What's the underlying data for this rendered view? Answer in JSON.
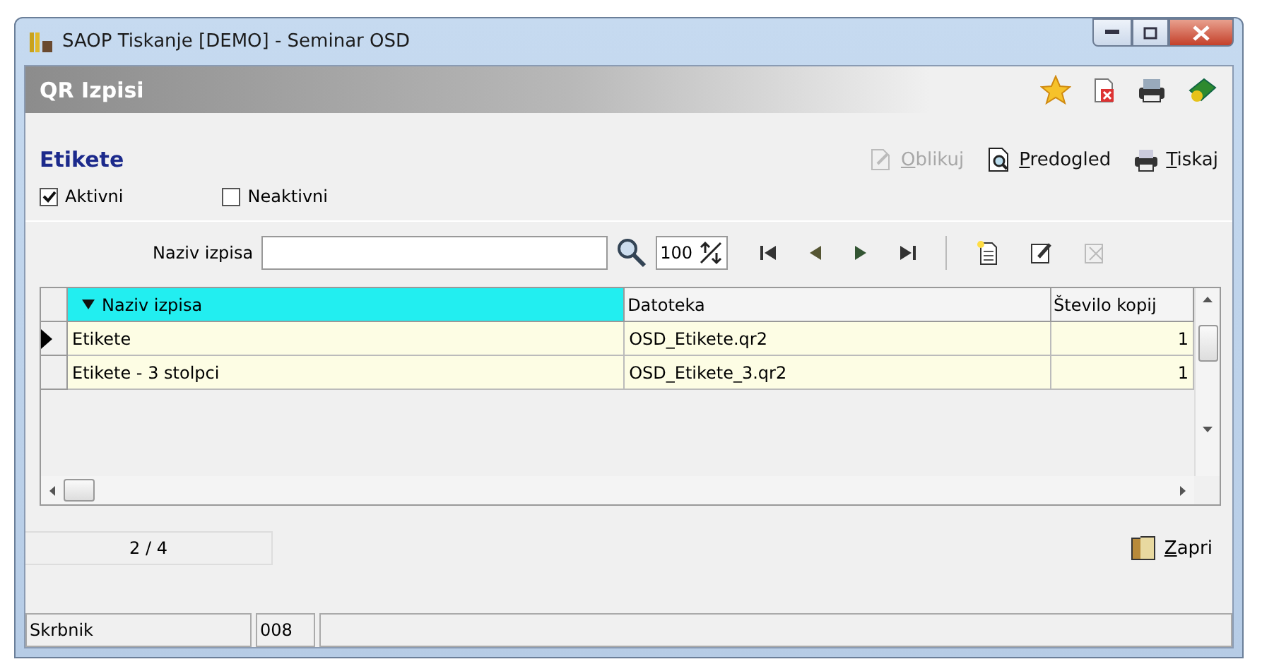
{
  "window": {
    "title": "SAOP Tiskanje [DEMO] - Seminar OSD"
  },
  "header": {
    "title": "QR Izpisi"
  },
  "section": {
    "title": "Etikete"
  },
  "actions": [
    {
      "label": "Oblikuj",
      "kind": "edit",
      "disabled": true
    },
    {
      "label": "Predogled",
      "kind": "preview",
      "disabled": false
    },
    {
      "label": "Tiskaj",
      "kind": "print",
      "disabled": false
    }
  ],
  "filters": [
    {
      "label": "Aktivni",
      "checked": true
    },
    {
      "label": "Neaktivni",
      "checked": false
    }
  ],
  "search": {
    "label": "Naziv izpisa",
    "limit": "100"
  },
  "table": {
    "columns": [
      {
        "label": "Naziv izpisa",
        "sorted": true
      },
      {
        "label": "Datoteka",
        "sorted": false
      },
      {
        "label": "Število kopij",
        "sorted": false
      }
    ],
    "rows": [
      {
        "cells": [
          "Etikete",
          "OSD_Etikete.qr2",
          "1"
        ],
        "selected": true
      },
      {
        "cells": [
          "Etikete - 3 stolpci",
          "OSD_Etikete_3.qr2",
          "1"
        ],
        "selected": false
      }
    ]
  },
  "counter": "2 / 4",
  "close_button": "Zapri",
  "status_bar": [
    "Skrbnik",
    "008"
  ]
}
